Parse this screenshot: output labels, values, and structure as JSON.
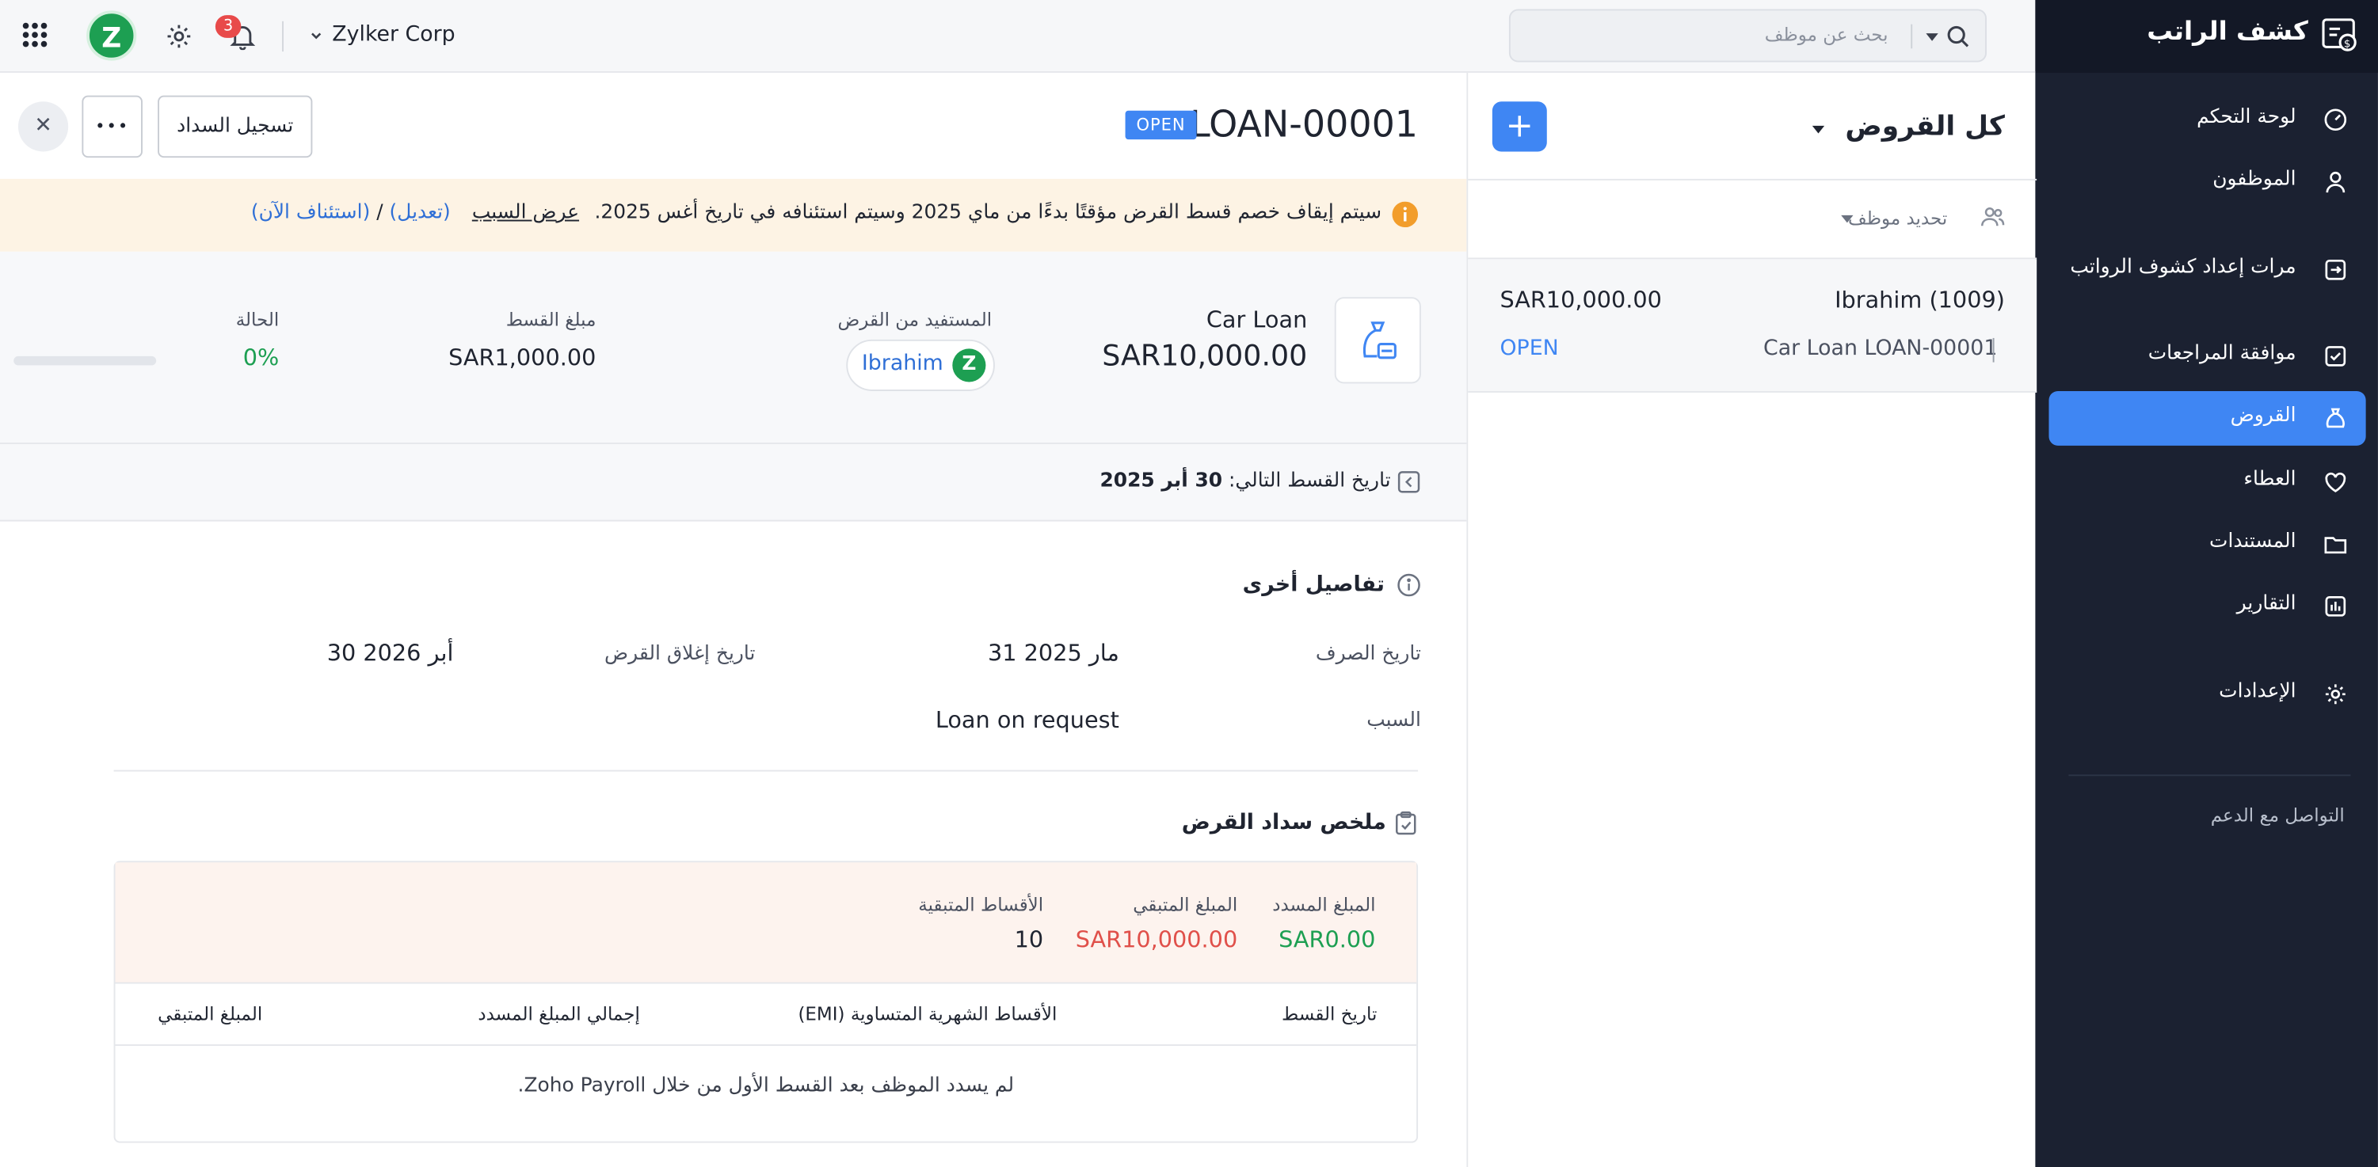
{
  "sidebar": {
    "brand": "كشف الراتب",
    "items": [
      {
        "label": "لوحة التحكم",
        "icon": "gauge-icon"
      },
      {
        "label": "الموظفون",
        "icon": "user-icon"
      },
      {
        "label": "مرات إعداد كشوف الرواتب",
        "icon": "payrun-icon"
      },
      {
        "label": "موافقة المراجعات",
        "icon": "check-square-icon"
      },
      {
        "label": "القروض",
        "icon": "money-bag-icon",
        "active": true
      },
      {
        "label": "العطاء",
        "icon": "heart-icon"
      },
      {
        "label": "المستندات",
        "icon": "folder-icon"
      },
      {
        "label": "التقارير",
        "icon": "bar-chart-icon"
      },
      {
        "label": "الإعدادات",
        "icon": "gear-icon"
      }
    ],
    "support": "التواصل مع الدعم"
  },
  "topbar": {
    "notifications_count": "3",
    "avatar_letter": "Z",
    "org_name": "Zylker Corp",
    "search_placeholder": "بحث عن موظف"
  },
  "list": {
    "title": "كل القروض",
    "add_label": "+",
    "filter_label": "تحديد موظف",
    "items": [
      {
        "employee": "Ibrahim (1009)",
        "amount": "SAR10,000.00",
        "loan_ref": "Car Loan LOAN-00001",
        "status": "OPEN"
      }
    ]
  },
  "detail": {
    "loan_id": "LOAN-00001",
    "status": "OPEN",
    "record_repayment": "تسجيل السداد",
    "more_label": "•••",
    "close_label": "✕",
    "banner": {
      "text": "سيتم إيقاف خصم قسط القرض مؤقتًا بدءًا من ماي 2025 وسيتم استئنافه في تاريخ أغس 2025.",
      "view_reason": "عرض السبب",
      "edit": "(تعديل)",
      "sep": "/",
      "resume": "(استئناف الآن)"
    },
    "summary": {
      "loan_name": "Car Loan",
      "loan_amount": "SAR10,000.00",
      "beneficiary_label": "المستفيد من القرض",
      "beneficiary_name": "Ibrahim",
      "beneficiary_initial": "Z",
      "installment_label": "مبلغ القسط",
      "installment_value": "SAR1,000.00",
      "status_label": "الحالة",
      "progress_percent": "0%",
      "progress_fraction": 0
    },
    "next_installment_label": "تاريخ القسط التالي:",
    "next_installment_date": "30 أبر 2025",
    "other_details": {
      "title": "تفاصيل أخرى",
      "disbursement_label": "تاريخ الصرف",
      "disbursement_value": "31 مار 2025",
      "closing_label": "تاريخ إغلاق القرض",
      "closing_value": "30 أبر 2026",
      "reason_label": "السبب",
      "reason_value": "Loan on request"
    },
    "repayment": {
      "title": "ملخص سداد القرض",
      "paid_label": "المبلغ المسدد",
      "paid_value": "SAR0.00",
      "remaining_label": "المبلغ المتبقي",
      "remaining_value": "SAR10,000.00",
      "remaining_installments_label": "الأقساط المتبقية",
      "remaining_installments_value": "10",
      "columns": [
        "تاريخ القسط",
        "الأقساط الشهرية المتساوية (EMI)",
        "إجمالي المبلغ المسدد",
        "المبلغ المتبقي"
      ],
      "empty_message": "لم يسدد الموظف بعد القسط الأول من خلال Zoho Payroll."
    }
  },
  "colors": {
    "sidebar_bg": "#1b2131",
    "accent": "#3f86f3",
    "banner_bg": "#fdf3e4",
    "success": "#1d9f52",
    "danger": "#e0504a"
  }
}
